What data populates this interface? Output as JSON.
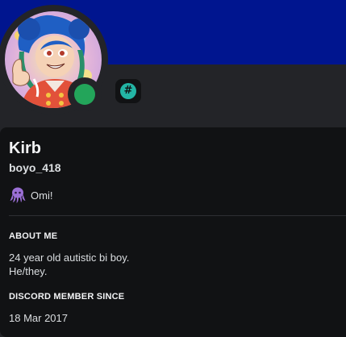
{
  "profile": {
    "display_name": "Kirb",
    "username": "boyo_418",
    "status": "online",
    "custom_status": {
      "emoji": "purple-octopus",
      "text": "Omi!"
    },
    "badge": {
      "icon": "hashtag-badge",
      "glyph": "#"
    }
  },
  "about": {
    "title": "ABOUT ME",
    "lines": [
      "24 year old autistic bi boy.",
      "He/they."
    ]
  },
  "member_since": {
    "title": "DISCORD MEMBER SINCE",
    "date": "18 Mar 2017"
  },
  "colors": {
    "banner": "#00158f",
    "background": "#232428",
    "card": "#111214",
    "online": "#23a55a",
    "badge_accent": "#23b5a5",
    "emoji": "#9b6fd6"
  }
}
